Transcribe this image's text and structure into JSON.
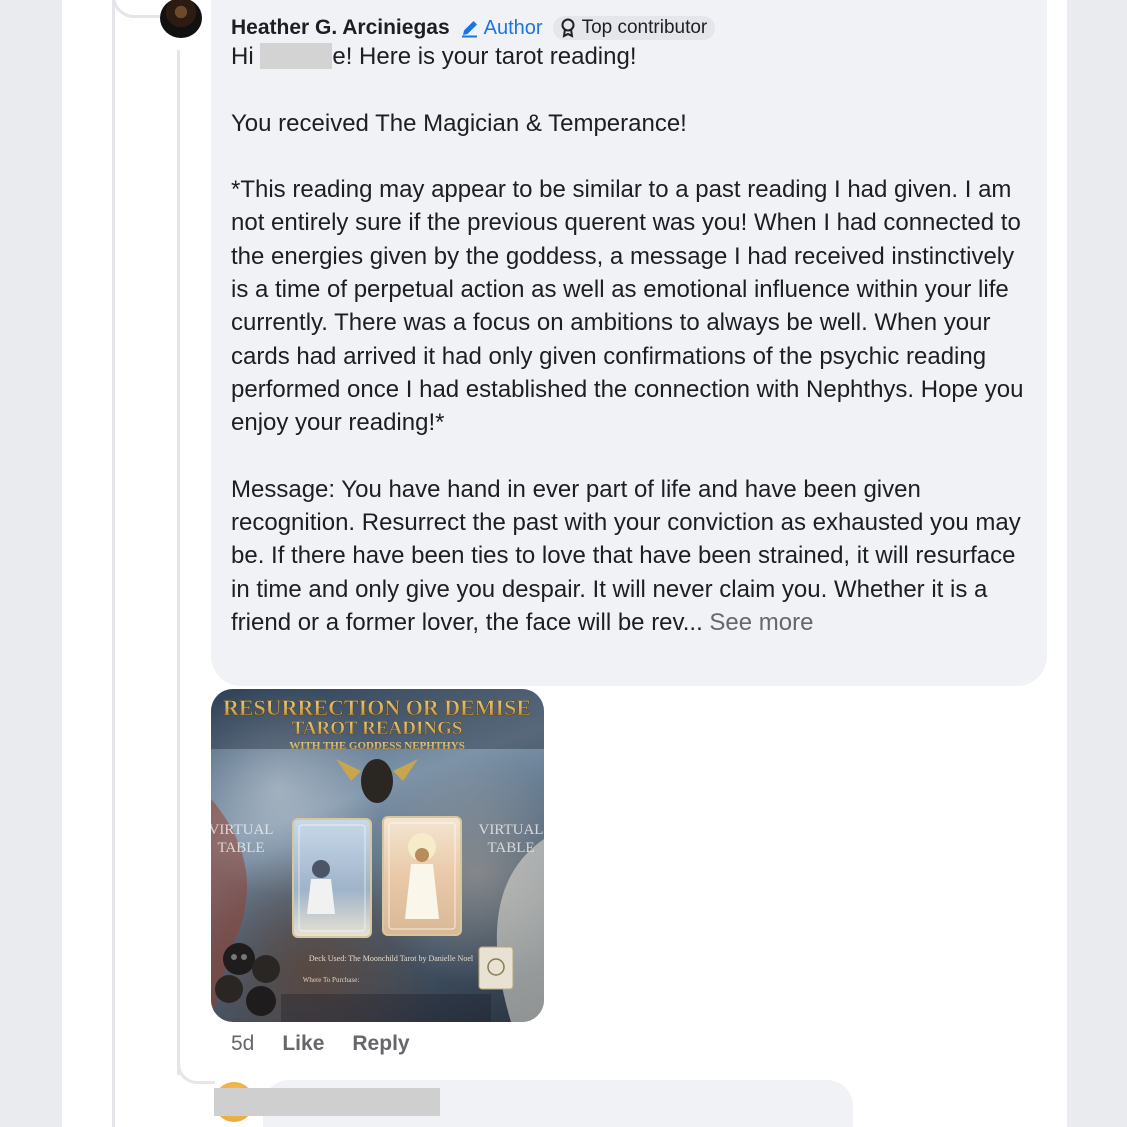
{
  "comment": {
    "author": "Heather G. Arciniegas",
    "author_badge": "Author",
    "top_badge": "Top contributor",
    "greeting_pre": "Hi",
    "greeting_post": "e! Here is your tarot reading!",
    "cards_line": "You received The Magician & Temperance!",
    "note": "*This reading may appear to be similar to a past reading I had given. I am not entirely sure if the previous querent was you! When I had connected to the energies given by the goddess, a message I had received instinctively is a time of perpetual action as well as emotional influence within your life currently. There was a focus on ambitions to always be well. When your cards had arrived it had only given confirmations of the psychic reading performed once I had established the connection with Nephthys. Hope you enjoy your reading!*",
    "message": "Message: You have hand in ever part of life and have been given recognition. Resurrect the past with your conviction as exhausted you may be. If there have been ties to love that have been strained, it will resurface in time and only give you despair. It will never claim you. Whether it is a friend or a former lover, the face will be rev...",
    "see_more": "See more"
  },
  "attachment": {
    "title_line1": "RESURRECTION OR DEMISE",
    "title_line2": "TAROT READINGS",
    "title_line3": "WITH THE GODDESS NEPHTHYS",
    "left_watermark_1": "VIRTUAL",
    "left_watermark_2": "TABLE",
    "right_watermark_1": "VIRTUAL",
    "right_watermark_2": "TABLE",
    "deck_line": "Deck Used: The Moonchild Tarot by Danielle Noel",
    "purchase_line": "Where To Purchase:"
  },
  "actions": {
    "time": "5d",
    "like": "Like",
    "reply": "Reply"
  },
  "colors": {
    "accent": "#1b74e4",
    "bubble": "#f0f2f5",
    "muted": "#65676b"
  }
}
